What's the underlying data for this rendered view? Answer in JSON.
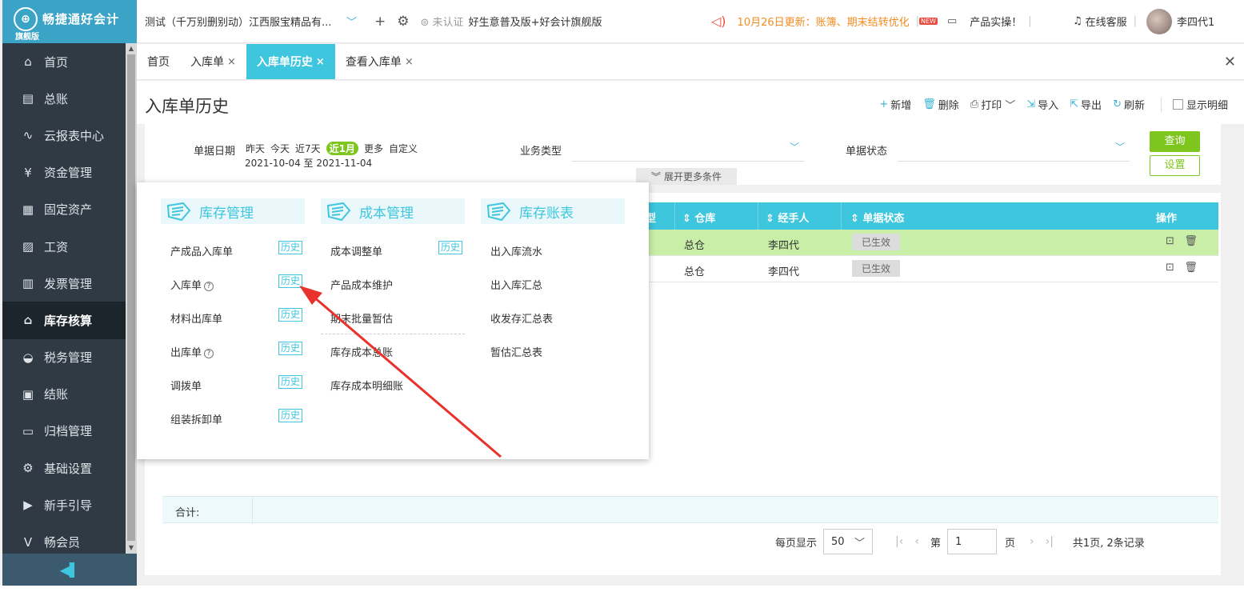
{
  "brand": {
    "name": "畅捷通好会计",
    "edition": "旗舰版"
  },
  "sidebar": {
    "items": [
      {
        "label": "首页",
        "icon": "home-icon",
        "glyph": "⌂"
      },
      {
        "label": "总账",
        "icon": "ledger-icon",
        "glyph": "▤"
      },
      {
        "label": "云报表中心",
        "icon": "chart-icon",
        "glyph": "∿"
      },
      {
        "label": "资金管理",
        "icon": "money-icon",
        "glyph": "¥"
      },
      {
        "label": "固定资产",
        "icon": "asset-icon",
        "glyph": "▦"
      },
      {
        "label": "工资",
        "icon": "salary-icon",
        "glyph": "▨"
      },
      {
        "label": "发票管理",
        "icon": "invoice-icon",
        "glyph": "▥"
      },
      {
        "label": "库存核算",
        "icon": "inventory-icon",
        "glyph": "⌂"
      },
      {
        "label": "税务管理",
        "icon": "tax-icon",
        "glyph": "◒"
      },
      {
        "label": "结账",
        "icon": "checkout-icon",
        "glyph": "▣"
      },
      {
        "label": "归档管理",
        "icon": "archive-icon",
        "glyph": "▭"
      },
      {
        "label": "基础设置",
        "icon": "settings-icon",
        "glyph": "⚙"
      },
      {
        "label": "新手引导",
        "icon": "guide-icon",
        "glyph": "▶"
      },
      {
        "label": "畅会员",
        "icon": "vip-icon",
        "glyph": "V"
      }
    ],
    "active_index": 7,
    "collapse_glyph": "◀▌"
  },
  "topbar": {
    "company": "测试（千万别删别动）江西服宝精品有...",
    "add_glyph": "+",
    "settings_glyph": "⚙",
    "cert_label": "未认证",
    "edition": "好生意普及版+好会计旗舰版",
    "notice": "10月26日更新：账簿、期末结转优化",
    "new_badge": "NEW",
    "product_demo": "产品实操！",
    "service": "在线客服",
    "user": "李四代1"
  },
  "tabs": [
    {
      "label": "首页",
      "closable": false
    },
    {
      "label": "入库单",
      "closable": true
    },
    {
      "label": "入库单历史",
      "closable": true,
      "active": true
    },
    {
      "label": "查看入库单",
      "closable": true
    }
  ],
  "page": {
    "title": "入库单历史",
    "toolbar": {
      "add": "新增",
      "delete": "删除",
      "print": "打印",
      "import": "导入",
      "export": "导出",
      "refresh": "刷新",
      "show_detail": "显示明细"
    },
    "filter": {
      "date_label": "单据日期",
      "quick_dates": [
        "昨天",
        "今天",
        "近7天",
        "近1月",
        "更多",
        "自定义"
      ],
      "quick_active": "近1月",
      "date_range": "2021-10-04 至 2021-11-04",
      "biz_type_label": "业务类型",
      "status_label": "单据状态",
      "query": "查询",
      "setting": "设置",
      "expand_more": "展开更多条件"
    },
    "table": {
      "columns": [
        "型",
        "仓库",
        "经手人",
        "单据状态",
        "操作"
      ],
      "rows": [
        {
          "warehouse": "总仓",
          "handler": "李四代",
          "status": "已生效"
        },
        {
          "warehouse": "总仓",
          "handler": "李四代",
          "status": "已生效"
        }
      ],
      "sum_label": "合计:"
    },
    "pager": {
      "per_page_label": "每页显示",
      "per_page": "50",
      "page_prefix": "第",
      "page": "1",
      "page_suffix": "页",
      "summary": "共1页, 2条记录"
    }
  },
  "popup": {
    "columns": [
      {
        "title": "库存管理",
        "items": [
          {
            "label": "产成品入库单",
            "history": "历史"
          },
          {
            "label": "入库单",
            "help": true,
            "history": "历史"
          },
          {
            "label": "材料出库单",
            "history": "历史"
          },
          {
            "label": "出库单",
            "help": true,
            "history": "历史"
          },
          {
            "label": "调拨单",
            "history": "历史"
          },
          {
            "label": "组装拆卸单",
            "history": "历史"
          }
        ]
      },
      {
        "title": "成本管理",
        "items": [
          {
            "label": "成本调整单",
            "history": "历史"
          },
          {
            "label": "产品成本维护"
          },
          {
            "label": "期末批量暂估"
          },
          {
            "label": "库存成本总账"
          },
          {
            "label": "库存成本明细账"
          }
        ]
      },
      {
        "title": "库存账表",
        "items": [
          {
            "label": "出入库流水"
          },
          {
            "label": "出入库汇总"
          },
          {
            "label": "收发存汇总表"
          },
          {
            "label": "暂估汇总表"
          }
        ]
      }
    ]
  },
  "colors": {
    "accent": "#3ec6de",
    "green": "#7ec61d",
    "sidebar": "#2f3a44",
    "arrow": "#e8322b"
  }
}
